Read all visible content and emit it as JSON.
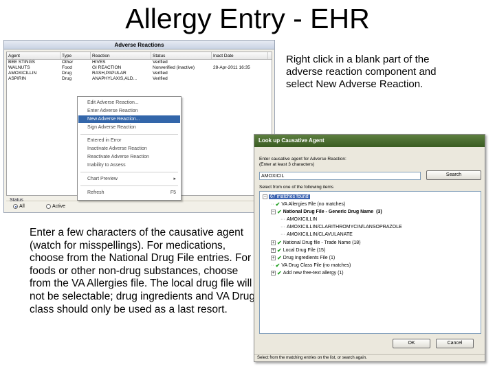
{
  "slide": {
    "title": "Allergy Entry - EHR",
    "instruction_1": "Right click in a blank part of the adverse reaction component and select New Adverse Reaction.",
    "instruction_2": "Enter a few characters of the causative agent (watch for misspellings). For medications, choose from the National Drug File entries. For foods or other non-drug substances, choose from the VA Allergies file. The local drug file will not be selectable; drug ingredients and VA Drug class should only be used as a last resort."
  },
  "adverse_reactions": {
    "title": "Adverse Reactions",
    "columns": [
      "Agent",
      "Type",
      "Reaction",
      "Status",
      "Inact Date"
    ],
    "rows": [
      {
        "agent": "BEE STINGS",
        "type": "Other",
        "reaction": "HIVES",
        "status": "Verified",
        "inact": ""
      },
      {
        "agent": "WALNUTS",
        "type": "Food",
        "reaction": "GI REACTION",
        "status": "Nonverified (inactive)",
        "inact": "28-Apr-2011 16:35"
      },
      {
        "agent": "AMOXICILLIN",
        "type": "Drug",
        "reaction": "RASH,PAPULAR",
        "status": "Verified",
        "inact": ""
      },
      {
        "agent": "ASPIRIN",
        "type": "Drug",
        "reaction": "ANAPHYLAXIS,ALD...",
        "status": "Verified",
        "inact": ""
      }
    ],
    "status_label": "Status",
    "radio_all": "All",
    "radio_active": "Active"
  },
  "context_menu": {
    "items": [
      {
        "label": "Edit Adverse Reaction..."
      },
      {
        "label": "Enter Adverse Reaction"
      },
      {
        "label": "New Adverse Reaction..."
      },
      {
        "label": "Sign Adverse Reaction"
      },
      {
        "label": "Entered in Error"
      },
      {
        "label": "Inactivate Adverse Reaction"
      },
      {
        "label": "Reactivate Adverse Reaction"
      },
      {
        "label": "Inability to Assess"
      },
      {
        "label": "Chart Preview"
      },
      {
        "label": "Refresh",
        "shortcut": "F5"
      }
    ],
    "submenu_arrow": "▸"
  },
  "lookup_dialog": {
    "title": "Look up Causative Agent",
    "prompt_line1": "Enter causative agent for Adverse Reaction:",
    "prompt_line2": "(Enter at least 3 characters)",
    "input_value": "AMOXICIL",
    "search_label": "Search",
    "select_label": "Select from one of the following items",
    "tree": {
      "root": "67 matches found",
      "va_allergies": "VA Allergies File (no matches)",
      "national_generic": "National Drug File - Generic Drug Name",
      "national_generic_count": "(3)",
      "generic_items": [
        "AMOXICILLIN",
        "AMOXICILLIN/CLARITHROMYCIN/LANSOPRAZOLE",
        "AMOXICILLIN/CLAVULANATE"
      ],
      "national_trade": "National Drug file - Trade Name (18)",
      "local_drug": "Local Drug File (15)",
      "ingredients": "Drug Ingredients File (1)",
      "drug_class": "VA Drug Class File (no matches)",
      "free_text": "Add new free-text allergy (1)"
    },
    "ok_label": "OK",
    "cancel_label": "Cancel",
    "status_text": "Select from the matching entries on the list, or search again."
  }
}
